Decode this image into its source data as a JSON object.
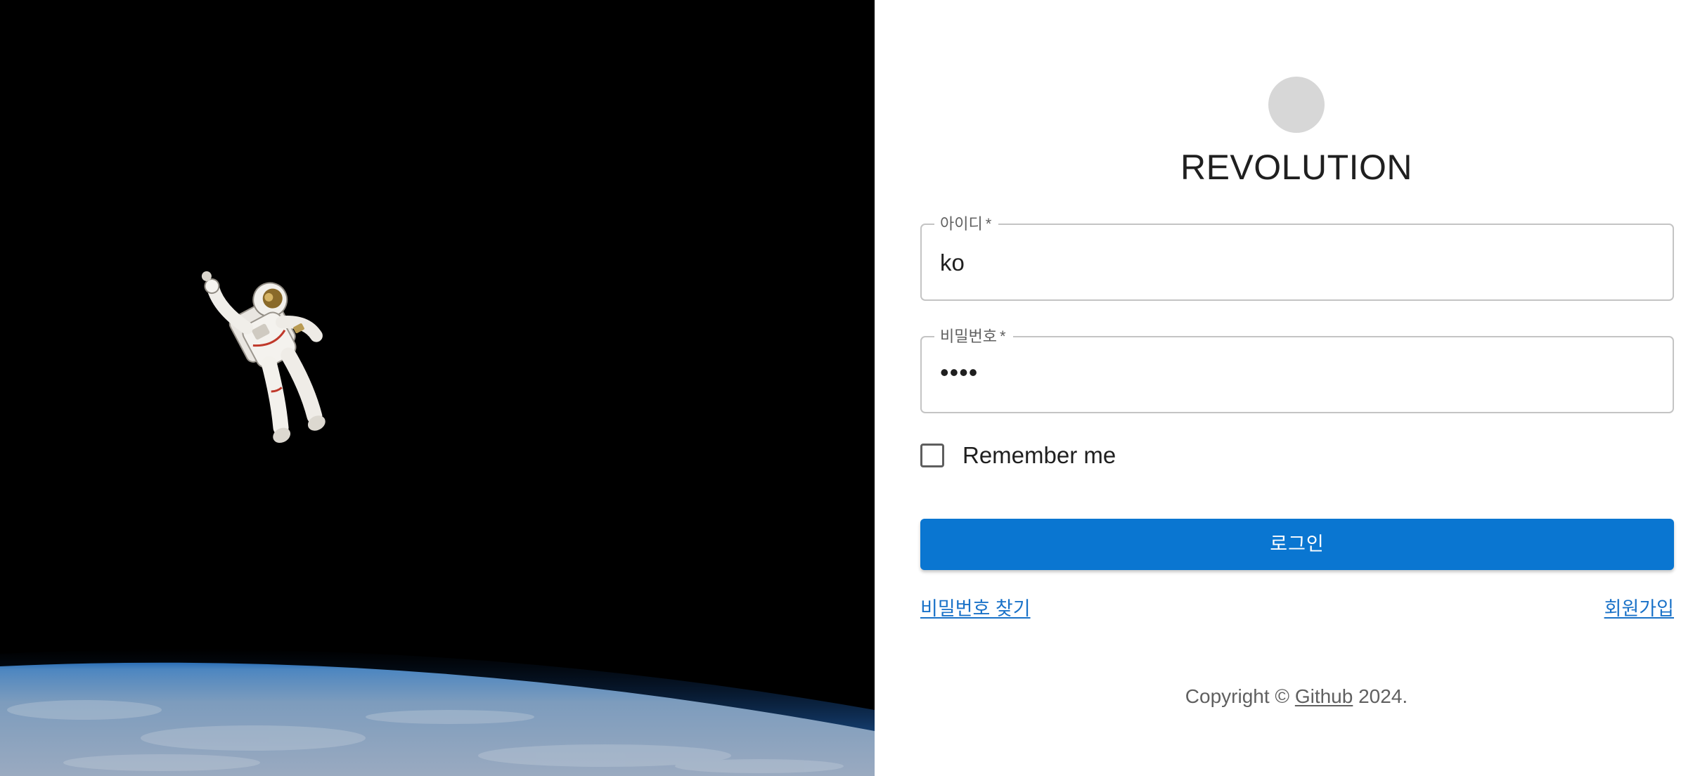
{
  "hero": {
    "image": "astronaut-floating-above-earth"
  },
  "brand": {
    "title": "REVOLUTION",
    "avatar_color": "#d7d7d7"
  },
  "form": {
    "userid": {
      "label": "아이디",
      "required_mark": "*",
      "value": "ko"
    },
    "password": {
      "label": "비밀번호",
      "required_mark": "*",
      "value_masked": "••••"
    },
    "remember": {
      "label": "Remember me",
      "checked": false
    },
    "submit_label": "로그인",
    "submit_color": "#0a76d1"
  },
  "links": {
    "find_password": "비밀번호 찾기",
    "signup": "회원가입",
    "color": "#1a72c8"
  },
  "footer": {
    "prefix": "Copyright © ",
    "link_text": "Github",
    "suffix": " 2024."
  }
}
